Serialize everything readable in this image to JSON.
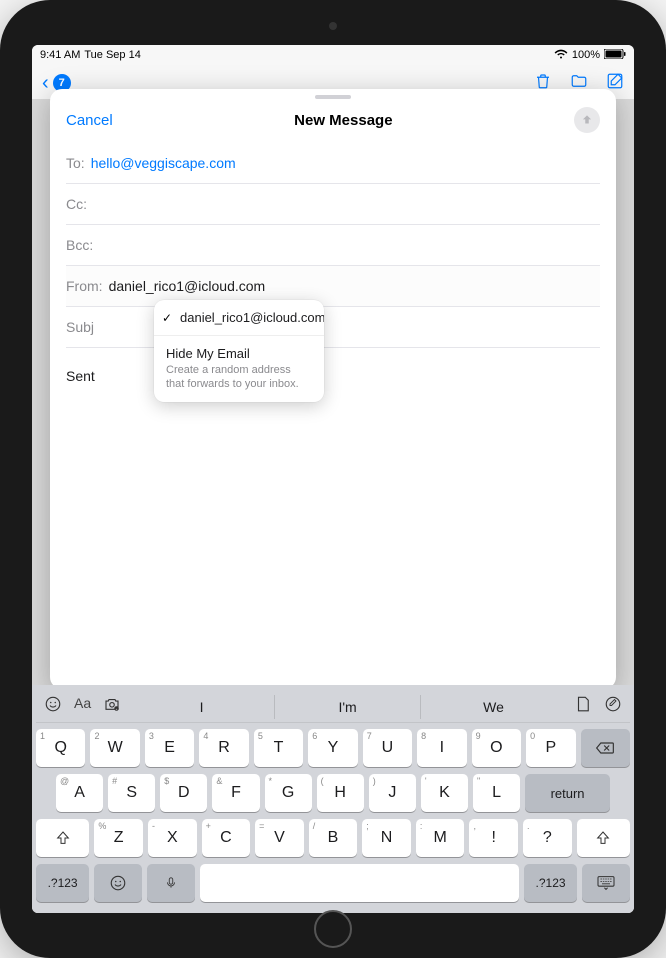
{
  "status": {
    "time": "9:41 AM",
    "date": "Tue Sep 14",
    "battery": "100%"
  },
  "mail_bg": {
    "back_count": "7"
  },
  "compose": {
    "cancel": "Cancel",
    "title": "New Message",
    "to_label": "To:",
    "to_value": "hello@veggiscape.com",
    "cc_label": "Cc:",
    "bcc_label": "Bcc:",
    "from_label": "From:",
    "from_value": "daniel_rico1@icloud.com",
    "subject_label": "Subj",
    "body_preview": "Sent"
  },
  "dropdown": {
    "selected": "daniel_rico1@icloud.com",
    "hide_title": "Hide My Email",
    "hide_sub": "Create a random address that forwards to your inbox."
  },
  "keyboard": {
    "suggestions": [
      "I",
      "I'm",
      "We"
    ],
    "row1": [
      {
        "main": "Q",
        "sup": "1"
      },
      {
        "main": "W",
        "sup": "2"
      },
      {
        "main": "E",
        "sup": "3"
      },
      {
        "main": "R",
        "sup": "4"
      },
      {
        "main": "T",
        "sup": "5"
      },
      {
        "main": "Y",
        "sup": "6"
      },
      {
        "main": "U",
        "sup": "7"
      },
      {
        "main": "I",
        "sup": "8"
      },
      {
        "main": "O",
        "sup": "9"
      },
      {
        "main": "P",
        "sup": "0"
      }
    ],
    "row2": [
      {
        "main": "A",
        "sup": "@"
      },
      {
        "main": "S",
        "sup": "#"
      },
      {
        "main": "D",
        "sup": "$"
      },
      {
        "main": "F",
        "sup": "&"
      },
      {
        "main": "G",
        "sup": "*"
      },
      {
        "main": "H",
        "sup": "("
      },
      {
        "main": "J",
        "sup": ")"
      },
      {
        "main": "K",
        "sup": "'"
      },
      {
        "main": "L",
        "sup": "\""
      }
    ],
    "row3": [
      {
        "main": "Z",
        "sup": "%"
      },
      {
        "main": "X",
        "sup": "-"
      },
      {
        "main": "C",
        "sup": "+"
      },
      {
        "main": "V",
        "sup": "="
      },
      {
        "main": "B",
        "sup": "/"
      },
      {
        "main": "N",
        "sup": ";"
      },
      {
        "main": "M",
        "sup": ":"
      },
      {
        "main": "!",
        "sup": ","
      },
      {
        "main": "?",
        "sup": "."
      }
    ],
    "return": "return",
    "numkey": ".?123"
  }
}
